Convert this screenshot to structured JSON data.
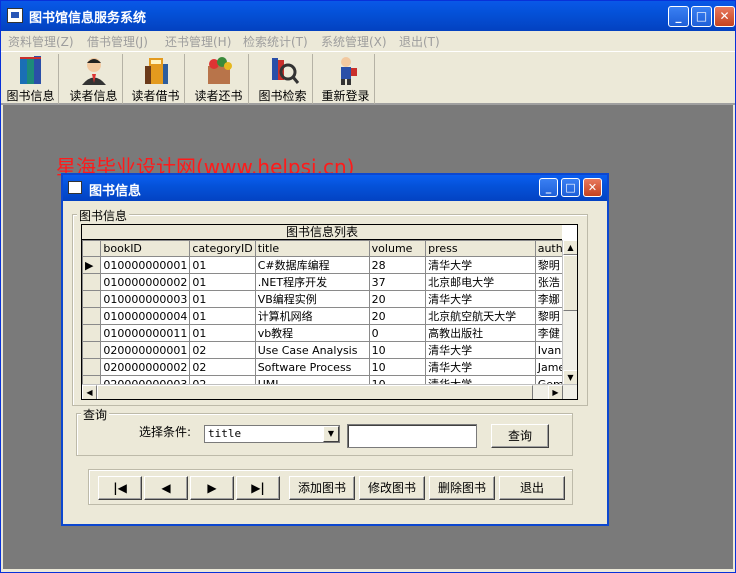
{
  "app": {
    "title": "图书馆信息服务系统",
    "menu": [
      "资料管理(Z)",
      "借书管理(J)",
      "还书管理(H)",
      "检索统计(T)",
      "系统管理(X)",
      "退出(T)"
    ],
    "toolbar": [
      "图书信息",
      "读者信息",
      "读者借书",
      "读者还书",
      "图书检索",
      "重新登录"
    ]
  },
  "watermark": "星海毕业设计网(www.helpsj.cn)",
  "child": {
    "title": "图书信息",
    "frame_books": "图书信息",
    "grid_caption": "图书信息列表",
    "columns": [
      "bookID",
      "categoryID",
      "title",
      "volume",
      "press",
      "author"
    ],
    "rows": [
      [
        "010000000001",
        "01",
        "C#数据库编程",
        "28",
        "清华大学",
        "黎明"
      ],
      [
        "010000000002",
        "01",
        ".NET程序开发",
        "37",
        "北京邮电大学",
        "张浩"
      ],
      [
        "010000000003",
        "01",
        "VB编程实例",
        "20",
        "清华大学",
        "李娜"
      ],
      [
        "010000000004",
        "01",
        "计算机网络",
        "20",
        "北京航空航天大学",
        "黎明"
      ],
      [
        "010000000011",
        "01",
        "vb教程",
        "0",
        "高教出版社",
        "李健"
      ],
      [
        "020000000001",
        "02",
        "Use Case Analysis",
        "10",
        "清华大学",
        "Ivan"
      ],
      [
        "020000000002",
        "02",
        "Software Process",
        "10",
        "清华大学",
        "James"
      ],
      [
        "020000000003",
        "02",
        "UML",
        "10",
        "清华大学",
        "Gemb"
      ]
    ],
    "query": {
      "legend": "查询",
      "label": "选择条件:",
      "selected": "title",
      "text_value": "",
      "button": "查询"
    },
    "nav": {
      "first": "|◀",
      "prev": "◀",
      "next": "▶",
      "last": "▶|"
    },
    "actions": [
      "添加图书",
      "修改图书",
      "删除图书",
      "退出"
    ]
  }
}
